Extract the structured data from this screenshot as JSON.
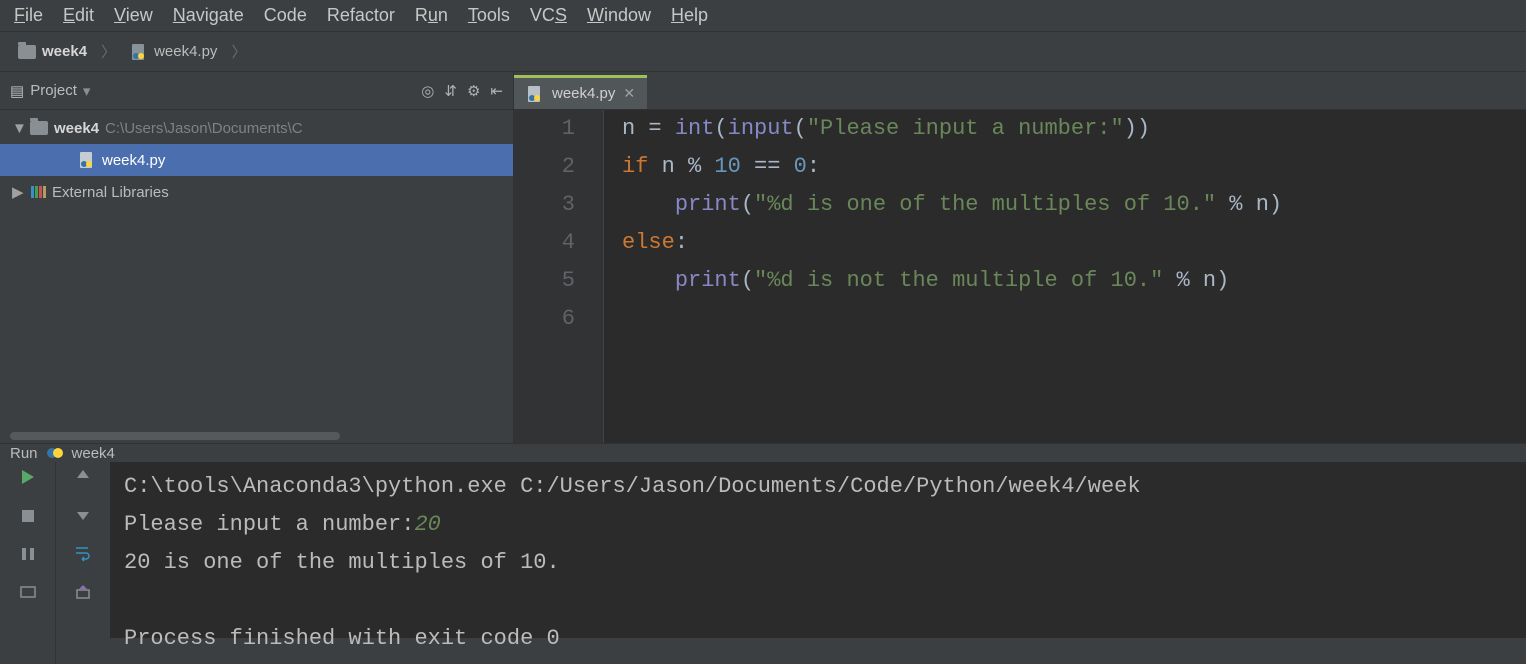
{
  "menu": [
    "File",
    "Edit",
    "View",
    "Navigate",
    "Code",
    "Refactor",
    "Run",
    "Tools",
    "VCS",
    "Window",
    "Help"
  ],
  "menu_underline_idx": [
    0,
    0,
    0,
    0,
    -1,
    -1,
    1,
    0,
    2,
    0,
    0
  ],
  "breadcrumb": {
    "folder": "week4",
    "file": "week4.py"
  },
  "sidebar": {
    "title": "Project",
    "root": {
      "name": "week4",
      "path": "C:\\Users\\Jason\\Documents\\C"
    },
    "file": "week4.py",
    "ext": "External Libraries"
  },
  "tab": {
    "name": "week4.py"
  },
  "code": {
    "lines": [
      1,
      2,
      3,
      4,
      5,
      6
    ],
    "l1_pre": "n = ",
    "l1_int": "int",
    "l1_input": "input",
    "l1_str": "\"Please input a number:\"",
    "l2_if": "if",
    "l2_body": " n % ",
    "l2_ten": "10",
    "l2_eq": " == ",
    "l2_zero": "0",
    "l2_colon": ":",
    "l3_indent": "    ",
    "l3_print": "print",
    "l3_str": "\"%d is one of the multiples of 10.\"",
    "l3_tail": " % n)",
    "l4_else": "else",
    "l4_colon": ":",
    "l5_indent": "    ",
    "l5_print": "print",
    "l5_str": "\"%d is not the multiple of 10.\"",
    "l5_tail": " % n)"
  },
  "run": {
    "title": "Run",
    "config": "week4",
    "cmd": "C:\\tools\\Anaconda3\\python.exe C:/Users/Jason/Documents/Code/Python/week4/week",
    "prompt": "Please input a number:",
    "input": "20",
    "out": "20 is one of the multiples of 10.",
    "exit": "Process finished with exit code 0"
  }
}
